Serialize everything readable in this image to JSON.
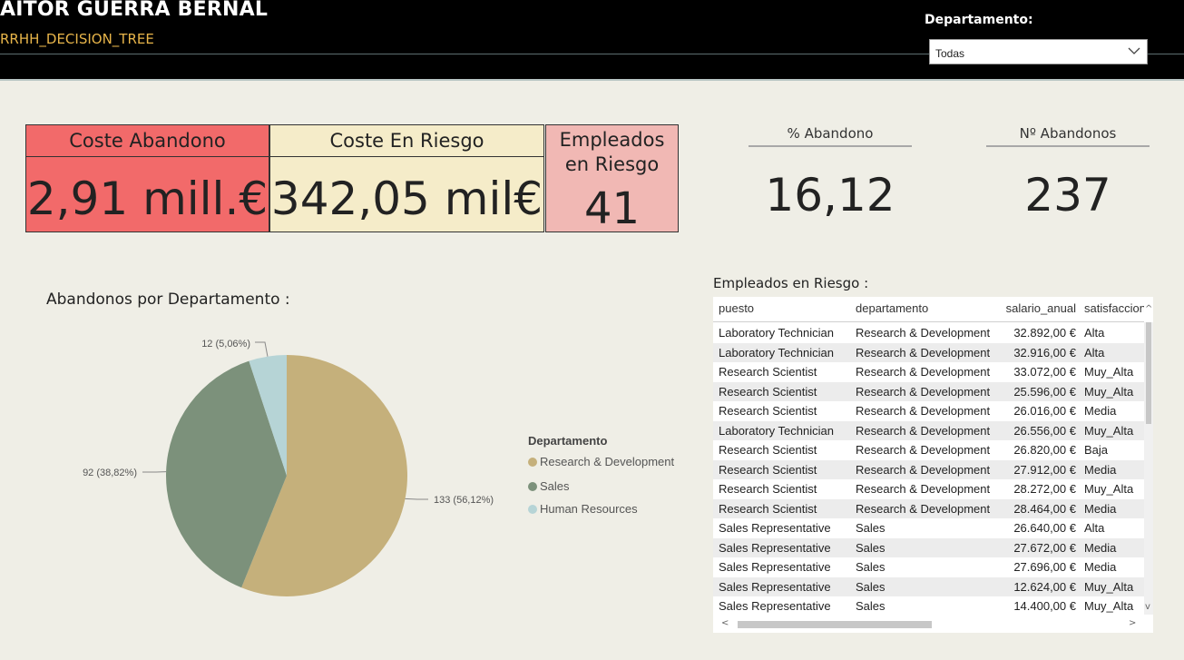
{
  "header": {
    "title": "AITOR GUERRA BERNAL",
    "subtitle": "RRHH_DECISION_TREE",
    "filter_label": "Departamento:",
    "filter_value": "Todas"
  },
  "cards": {
    "coste_abandono": {
      "label": "Coste Abandono",
      "value": "2,91 mill.€"
    },
    "coste_riesgo": {
      "label": "Coste En Riesgo",
      "value": "342,05 mil€"
    },
    "empleados_riesgo": {
      "label_line1": "Empleados",
      "label_line2": "en Riesgo",
      "value": "41"
    }
  },
  "kpis": {
    "pct_abandono": {
      "label": "% Abandono",
      "value": "16,12"
    },
    "n_abandonos": {
      "label": "Nº Abandonos",
      "value": "237"
    }
  },
  "pie_section": {
    "title": "Abandonos por Departamento :",
    "legend_title": "Departamento"
  },
  "chart_data": {
    "type": "pie",
    "title": "Abandonos por Departamento :",
    "legend_title": "Departamento",
    "legend_position": "right",
    "slices": [
      {
        "name": "Research & Development",
        "value": 133,
        "label": "133 (56,12%)",
        "color": "#c5b07b"
      },
      {
        "name": "Sales",
        "value": 92,
        "label": "92 (38,82%)",
        "color": "#7c917b"
      },
      {
        "name": "Human Resources",
        "value": 12,
        "label": "12 (5,06%)",
        "color": "#b6d4d6"
      }
    ]
  },
  "table": {
    "title": "Empleados en Riesgo :",
    "columns": [
      "puesto",
      "departamento",
      "salario_anual",
      "satisfaccion"
    ],
    "rows": [
      [
        "Laboratory Technician",
        "Research & Development",
        "32.892,00 €",
        "Alta"
      ],
      [
        "Laboratory Technician",
        "Research & Development",
        "32.916,00 €",
        "Alta"
      ],
      [
        "Research Scientist",
        "Research & Development",
        "33.072,00 €",
        "Muy_Alta"
      ],
      [
        "Research Scientist",
        "Research & Development",
        "25.596,00 €",
        "Muy_Alta"
      ],
      [
        "Research Scientist",
        "Research & Development",
        "26.016,00 €",
        "Media"
      ],
      [
        "Laboratory Technician",
        "Research & Development",
        "26.556,00 €",
        "Muy_Alta"
      ],
      [
        "Research Scientist",
        "Research & Development",
        "26.820,00 €",
        "Baja"
      ],
      [
        "Research Scientist",
        "Research & Development",
        "27.912,00 €",
        "Media"
      ],
      [
        "Research Scientist",
        "Research & Development",
        "28.272,00 €",
        "Muy_Alta"
      ],
      [
        "Research Scientist",
        "Research & Development",
        "28.464,00 €",
        "Media"
      ],
      [
        "Sales Representative",
        "Sales",
        "26.640,00 €",
        "Alta"
      ],
      [
        "Sales Representative",
        "Sales",
        "27.672,00 €",
        "Media"
      ],
      [
        "Sales Representative",
        "Sales",
        "27.696,00 €",
        "Media"
      ],
      [
        "Sales Representative",
        "Sales",
        "12.624,00 €",
        "Muy_Alta"
      ],
      [
        "Sales Representative",
        "Sales",
        "14.400,00 €",
        "Muy_Alta"
      ]
    ]
  }
}
